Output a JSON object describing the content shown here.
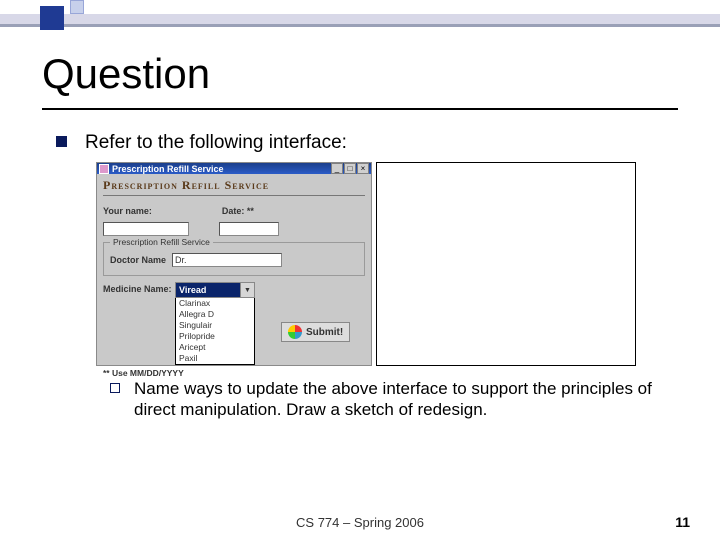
{
  "title": "Question",
  "bullet": "Refer to the following interface:",
  "sub_bullet": "Name ways to update the above interface to support the principles of direct manipulation. Draw a sketch of redesign.",
  "footer": "CS 774 – Spring 2006",
  "page": "11",
  "app": {
    "titlebar": "Prescription Refill Service",
    "heading": "Prescription Refill Service",
    "your_name_label": "Your name:",
    "date_label": "Date: **",
    "group_legend": "Prescription Refill Service",
    "doctor_label": "Doctor Name",
    "doctor_prefix": "Dr.",
    "medicine_label": "Medicine Name:",
    "selected": "Viread",
    "options": [
      "Clarinax",
      "Allegra D",
      "Singulair",
      "Prilopride",
      "Aricept",
      "Paxil"
    ],
    "submit": "Submit!",
    "hint": "** Use MM/DD/YYYY"
  }
}
